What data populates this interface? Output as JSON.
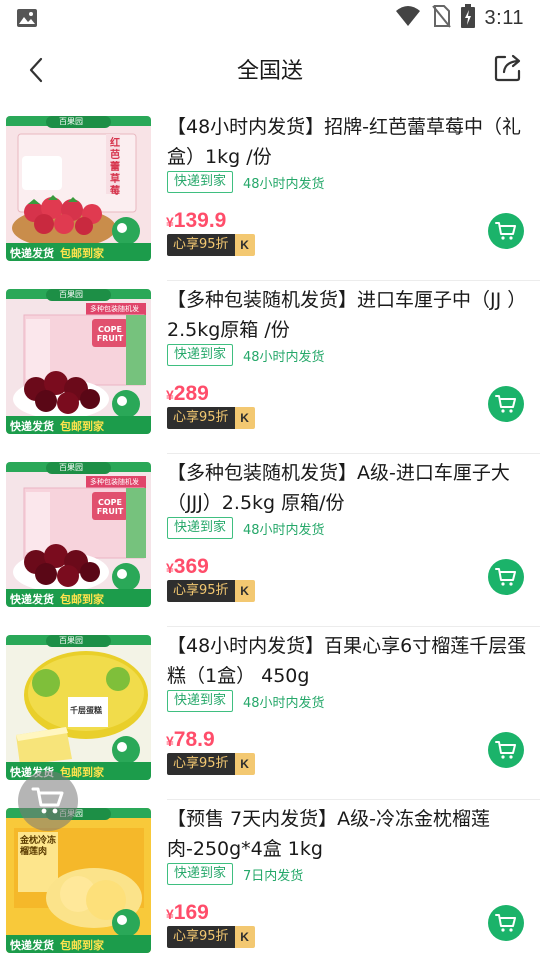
{
  "status_bar": {
    "time": "3:11"
  },
  "header": {
    "title": "全国送"
  },
  "products": [
    {
      "name": "【48小时内发货】招牌-红芭蕾草莓中（礼盒）1kg /份",
      "tag": "快递到家",
      "ship_note": "48小时内发货",
      "currency": "¥",
      "price": "139.9",
      "member_label": "心享95折",
      "member_logo": "K",
      "thumb": {
        "banner_top": "百果园",
        "badge_left": "快递发货",
        "badge_right": "包邮到家",
        "box_text": "红芭蕾草莓",
        "bg": "#f6dfe2",
        "accent": "#d6334b"
      }
    },
    {
      "name": "【多种包装随机发货】进口车厘子中（JJ ）2.5kg原箱 /份",
      "tag": "快递到家",
      "ship_note": "48小时内发货",
      "currency": "¥",
      "price": "289",
      "member_label": "心享95折",
      "member_logo": "K",
      "thumb": {
        "banner_top": "百果园",
        "banner_sub": "多种包装随机发",
        "badge_left": "快递发货",
        "badge_right": "包邮到家",
        "box_text": "COPE FRUIT",
        "bg": "#f3dbe1",
        "accent": "#7a0c1e"
      }
    },
    {
      "name": "【多种包装随机发货】A级-进口车厘子大（JJJ）2.5kg 原箱/份",
      "tag": "快递到家",
      "ship_note": "48小时内发货",
      "currency": "¥",
      "price": "369",
      "member_label": "心享95折",
      "member_logo": "K",
      "thumb": {
        "banner_top": "百果园",
        "banner_sub": "多种包装随机发",
        "badge_left": "快递发货",
        "badge_right": "包邮到家",
        "box_text": "COPE FRUIT",
        "bg": "#f3dbe1",
        "accent": "#7a0c1e"
      }
    },
    {
      "name": "【48小时内发货】百果心享6寸榴莲千层蛋糕（1盒） 450g",
      "tag": "快递到家",
      "ship_note": "48小时内发货",
      "currency": "¥",
      "price": "78.9",
      "member_label": "心享95折",
      "member_logo": "K",
      "thumb": {
        "banner_top": "百果园",
        "badge_left": "快递发货",
        "badge_right": "包邮到家",
        "box_text": "千层蛋糕",
        "bg": "#f7f0c4",
        "accent": "#e9cf2a"
      }
    },
    {
      "name": "【预售 7天内发货】A级-冷冻金枕榴莲肉-250g*4盒 1kg",
      "tag": "快递到家",
      "ship_note": "7日内发货",
      "currency": "¥",
      "price": "169",
      "member_label": "心享95折",
      "member_logo": "K",
      "thumb": {
        "banner_top": "百果园",
        "badge_left": "快递发货",
        "badge_right": "包邮到家",
        "box_text": "金枕冷冻榴莲肉",
        "bg": "#f8c93a",
        "accent": "#f2a91d"
      }
    }
  ],
  "colors": {
    "accent_green": "#1bb36a",
    "price_red": "#ff4d6a",
    "tag_green": "#26a86a"
  }
}
